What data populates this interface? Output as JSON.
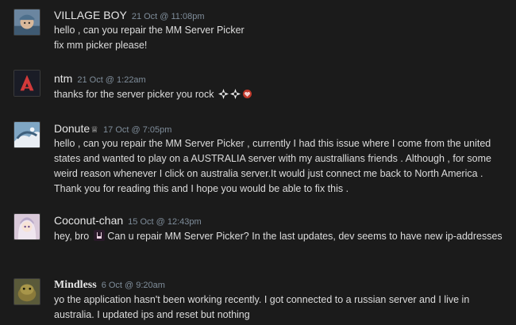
{
  "comments": [
    {
      "author": "VILLAGE BOY",
      "timestamp": "21 Oct @ 11:08pm",
      "lines": [
        "hello , can you repair the MM Server Picker",
        "fix mm picker please!"
      ]
    },
    {
      "author": "ntm",
      "timestamp": "21 Oct @ 1:22am",
      "text": "thanks for the server picker you rock",
      "emotes": [
        "star-burst-icon",
        "star-burst-icon",
        "heart-badge-icon"
      ]
    },
    {
      "author": "Donute",
      "author_badge": "♕",
      "timestamp": "17 Oct @ 7:05pm",
      "text": "hello , can you repair the MM Server Picker , currently I had this issue where I come from the united states and wanted to play on a AUSTRALIA server with my australlians friends . Although , for some weird reason whenever I click on australia server.It would just connect me back to North America . Thank you for reading this and I hope you would be able to fix this ."
    },
    {
      "author": "Coconut-chan",
      "timestamp": "15 Oct @ 12:43pm",
      "text_before": "hey, bro",
      "emote": "rock-hand-icon",
      "text_after": "Can u repair MM Server Picker? In the last updates, dev seems to have new ip-addresses"
    },
    {
      "author": "Mindless",
      "timestamp": "6 Oct @ 9:20am",
      "text": "yo the application hasn't been working recently. I got connected to a russian server and I live in australia. I updated ips and reset but nothing"
    }
  ],
  "colors": {
    "background": "#1b1b1b",
    "author": "#e6e6e6",
    "timestamp": "#7f8d9a",
    "text": "#dcdcdc"
  }
}
